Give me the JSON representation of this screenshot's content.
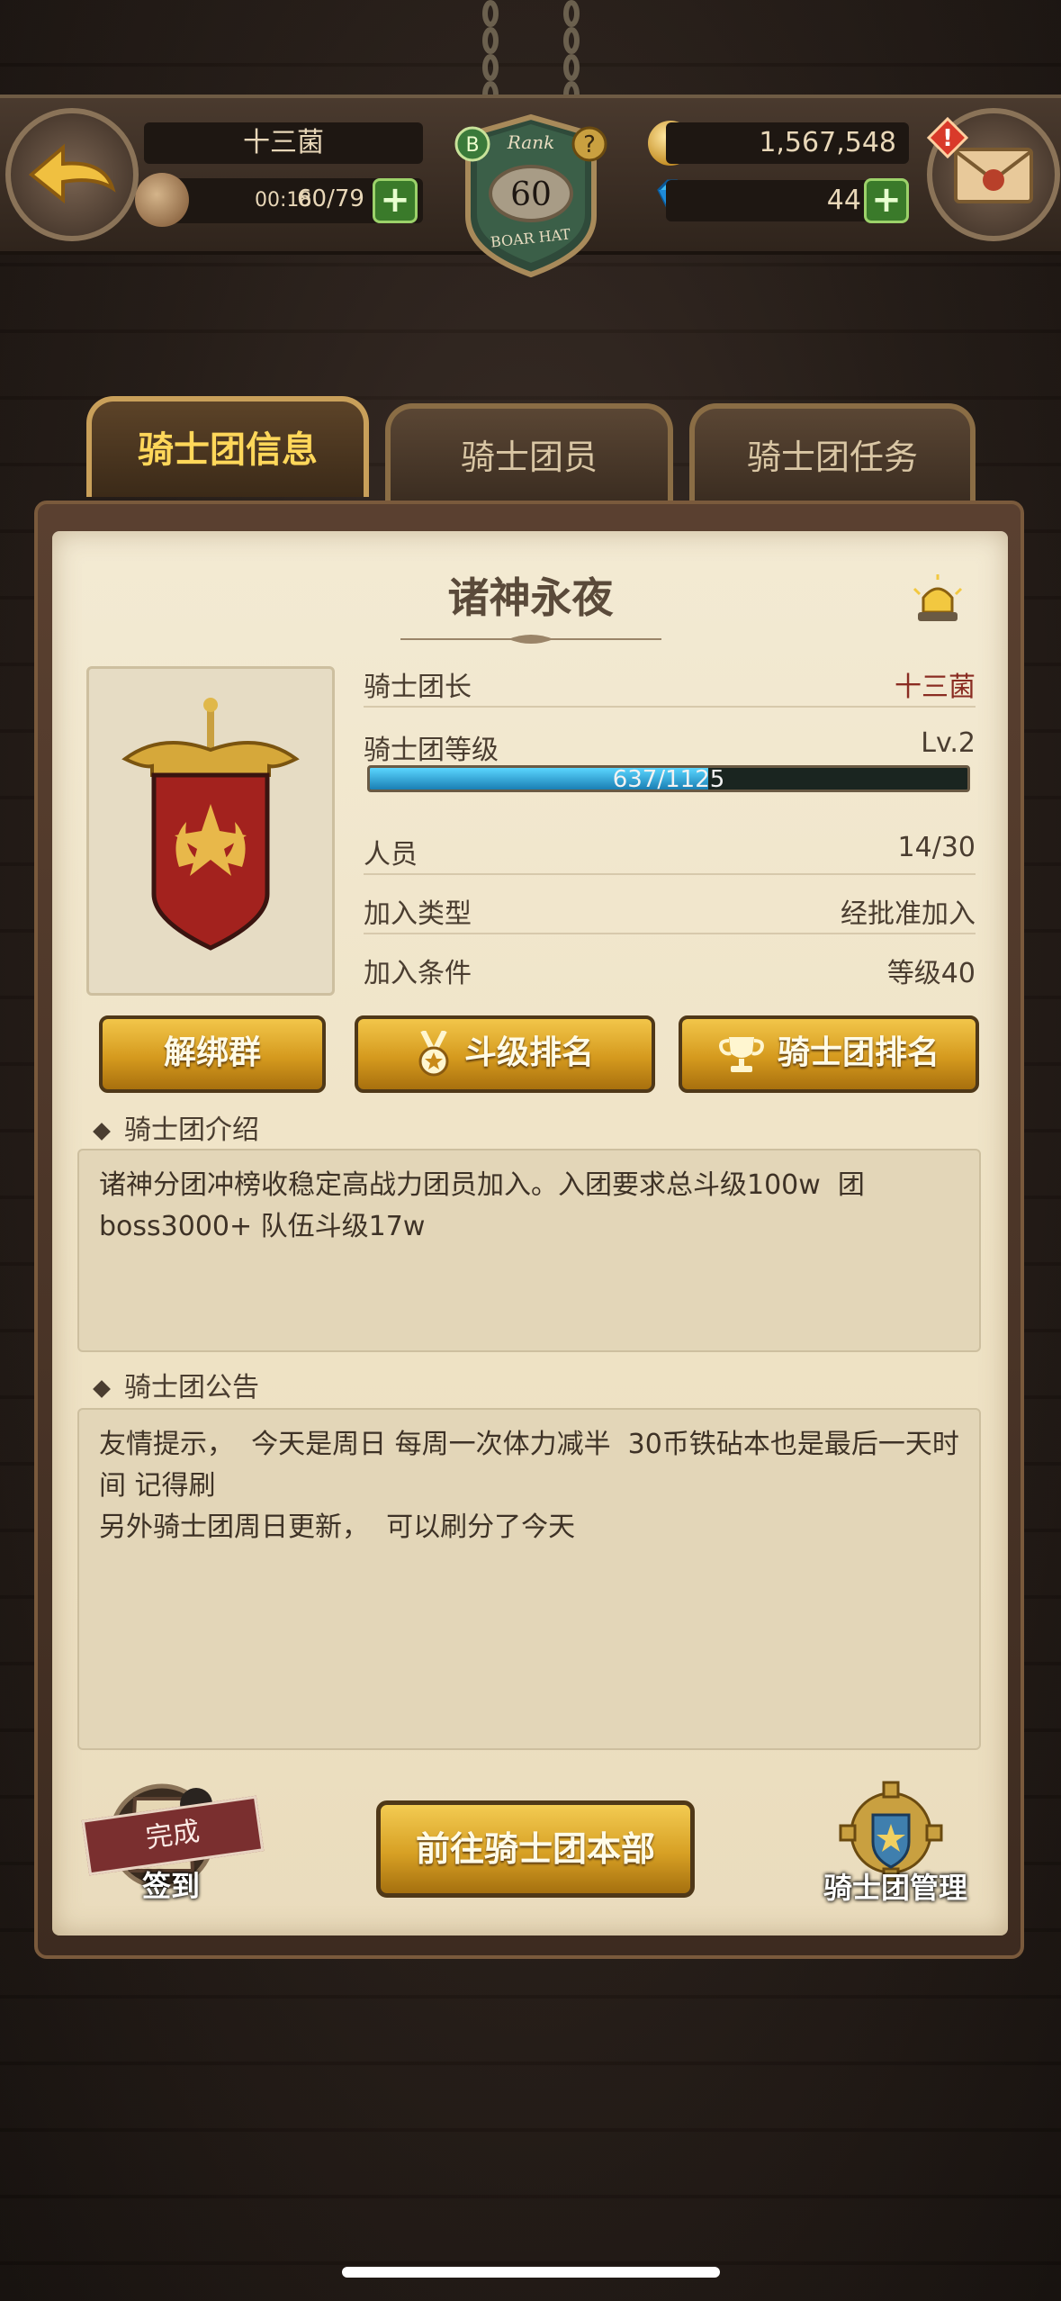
{
  "header": {
    "player_name": "十三菌",
    "stamina_timer": "00:18",
    "stamina": "60/79",
    "rank_label": "Rank",
    "rank_value": "60",
    "rank_badge_text": "BOAR HAT",
    "rank_tier": "B",
    "gold": "1,567,548",
    "gems": "441"
  },
  "tabs": [
    {
      "label": "骑士团信息",
      "active": true
    },
    {
      "label": "骑士团员",
      "active": false
    },
    {
      "label": "骑士团任务",
      "active": false
    }
  ],
  "guild": {
    "name": "诸神永夜",
    "leader_label": "骑士团长",
    "leader_value": "十三菌",
    "level_label": "骑士团等级",
    "level_value": "Lv.2",
    "exp_text": "637/1125",
    "exp_fraction": 0.566,
    "members_label": "人员",
    "members_value": "14/30",
    "join_type_label": "加入类型",
    "join_type_value": "经批准加入",
    "join_cond_label": "加入条件",
    "join_cond_value": "等级40"
  },
  "buttons": {
    "unbind": "解绑群",
    "battle_rank": "斗级排名",
    "guild_rank": "骑士团排名",
    "go_hq": "前往骑士团本部",
    "checkin_label": "签到",
    "checkin_status": "完成",
    "manage": "骑士团管理"
  },
  "intro": {
    "title": "骑士团介绍",
    "text": "诸神分团冲榜收稳定高战力团员加入。入团要求总斗级100w  团boss3000+ 队伍斗级17w"
  },
  "notice": {
    "title": "骑士团公告",
    "text": "友情提示，  今天是周日 每周一次体力减半  30币铁砧本也是最后一天时间 记得刷\n另外骑士团周日更新，  可以刷分了今天"
  },
  "colors": {
    "tab_active_text": "#ffd75a",
    "leader_name": "#8a2c22",
    "exp_fill": "#1a7fb4",
    "gold_button": "#d59a1e"
  }
}
